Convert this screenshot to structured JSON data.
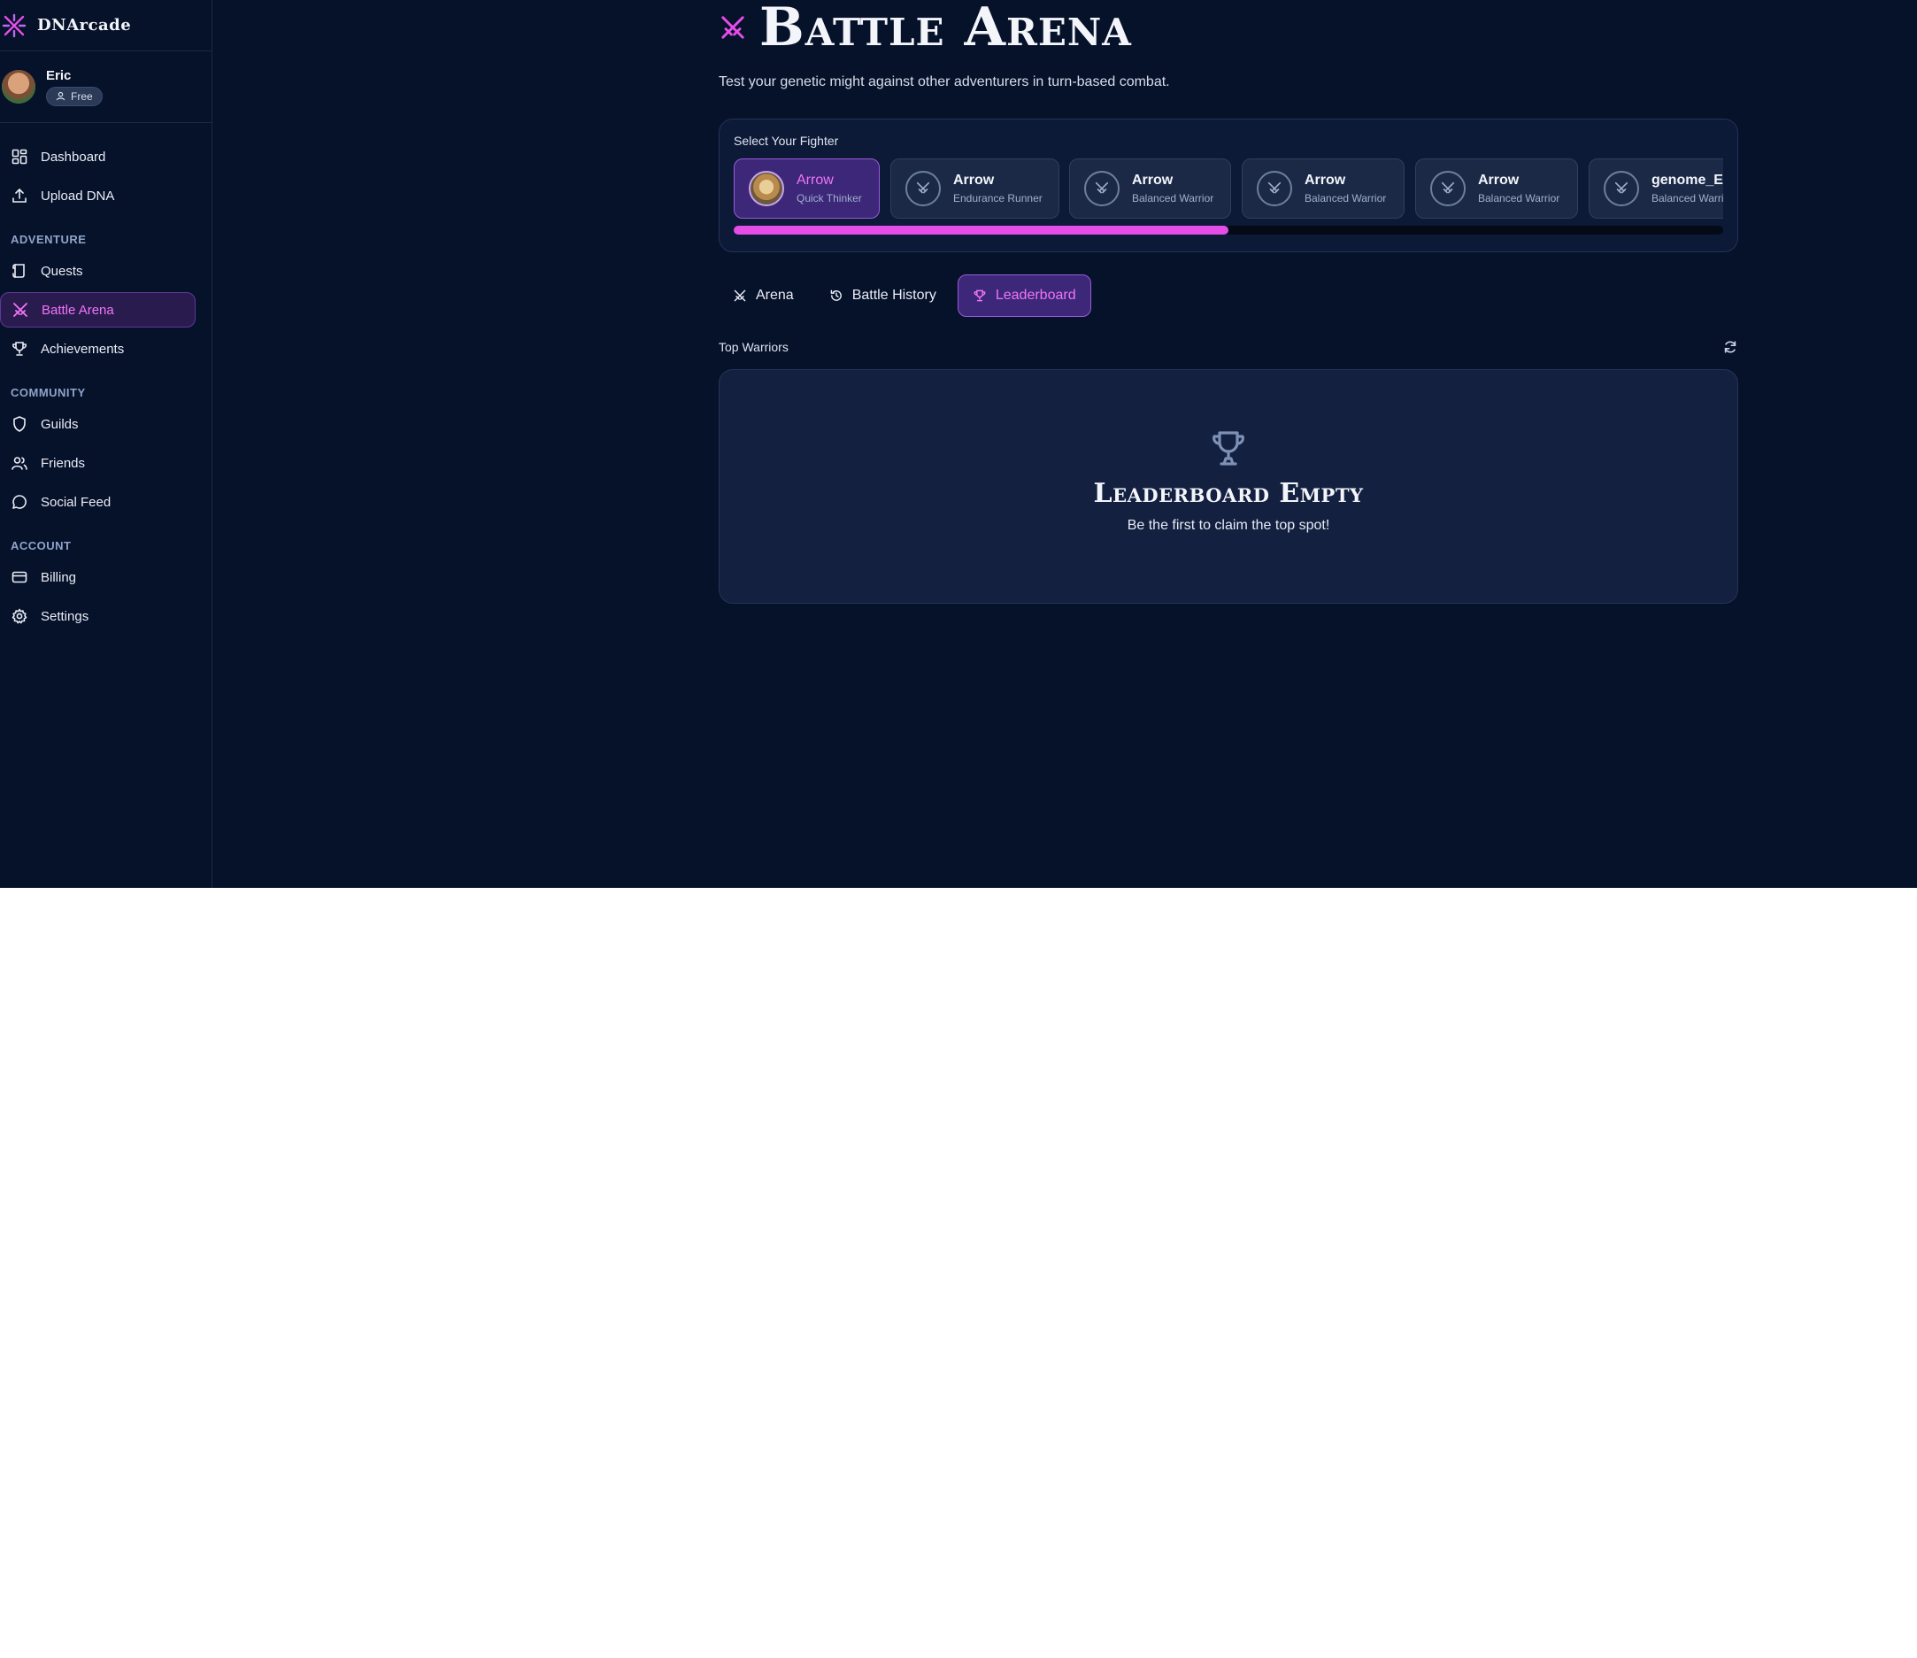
{
  "brand": {
    "name": "DNArcade",
    "accent": "#e44de8"
  },
  "user": {
    "name": "Eric",
    "plan": "Free"
  },
  "nav": {
    "top": [
      {
        "label": "Dashboard",
        "icon": "dashboard-icon"
      },
      {
        "label": "Upload DNA",
        "icon": "upload-icon"
      }
    ],
    "sections": [
      {
        "title": "ADVENTURE",
        "items": [
          {
            "label": "Quests",
            "icon": "scroll-icon"
          },
          {
            "label": "Battle Arena",
            "icon": "crossed-swords-icon",
            "active": true
          },
          {
            "label": "Achievements",
            "icon": "trophy-icon"
          }
        ]
      },
      {
        "title": "COMMUNITY",
        "items": [
          {
            "label": "Guilds",
            "icon": "shield-icon"
          },
          {
            "label": "Friends",
            "icon": "users-icon"
          },
          {
            "label": "Social Feed",
            "icon": "chat-bubble-icon"
          }
        ]
      },
      {
        "title": "ACCOUNT",
        "items": [
          {
            "label": "Billing",
            "icon": "credit-card-icon"
          },
          {
            "label": "Settings",
            "icon": "gear-icon"
          }
        ]
      }
    ]
  },
  "page": {
    "title": "Battle Arena",
    "subtitle": "Test your genetic might against other adventurers in turn-based combat."
  },
  "fighter_select": {
    "label": "Select Your Fighter",
    "fighters": [
      {
        "name": "Arrow",
        "class": "Quick Thinker",
        "selected": true
      },
      {
        "name": "Arrow",
        "class": "Endurance Runner"
      },
      {
        "name": "Arrow",
        "class": "Balanced Warrior"
      },
      {
        "name": "Arrow",
        "class": "Balanced Warrior"
      },
      {
        "name": "Arrow",
        "class": "Balanced Warrior"
      },
      {
        "name": "genome_Eric",
        "class": "Balanced Warrior"
      }
    ],
    "scroll_progress": 0.5
  },
  "tabs": [
    {
      "label": "Arena",
      "icon": "crossed-swords-icon"
    },
    {
      "label": "Battle History",
      "icon": "history-icon"
    },
    {
      "label": "Leaderboard",
      "icon": "trophy-icon",
      "active": true
    }
  ],
  "leaderboard": {
    "label": "Top Warriors",
    "empty_title": "Leaderboard Empty",
    "empty_subtitle": "Be the first to claim the top spot!"
  }
}
